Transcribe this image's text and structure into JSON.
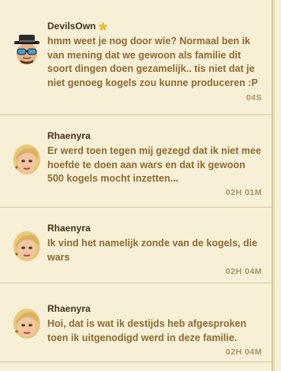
{
  "messages": [
    {
      "author": "DevilsOwn",
      "vip": true,
      "avatar_icon": "mobster-hat-sunglasses-avatar",
      "text": "hmm weet je nog door wie? Normaal ben ik van mening dat we gewoon als familie dit soort dingen doen gezamelijk.. tis niet dat je niet genoeg kogels zou kunne produceren :P",
      "time": "04S"
    },
    {
      "author": "Rhaenyra",
      "vip": false,
      "avatar_icon": "blonde-woman-avatar",
      "text": "Er werd toen tegen mij gezegd dat ik niet mee hoefde te doen aan wars en dat ik gewoon 500 kogels mocht inzetten...",
      "time": "02H 01M"
    },
    {
      "author": "Rhaenyra",
      "vip": false,
      "avatar_icon": "blonde-woman-avatar",
      "text": "Ik vind het namelijk zonde van de kogels, die wars",
      "time": "02H 04M"
    },
    {
      "author": "Rhaenyra",
      "vip": false,
      "avatar_icon": "blonde-woman-avatar",
      "text": "Hoi, dat is wat ik destijds heb afgesproken toen ik uitgenodigd werd in deze familie.",
      "time": "02H 04M"
    }
  ],
  "colors": {
    "background": "#f7efd6",
    "author": "#43361c",
    "message_text": "#8d6c31",
    "time": "#a79466",
    "divider": "#d9caa0",
    "vip_star": "#f2c21b"
  }
}
